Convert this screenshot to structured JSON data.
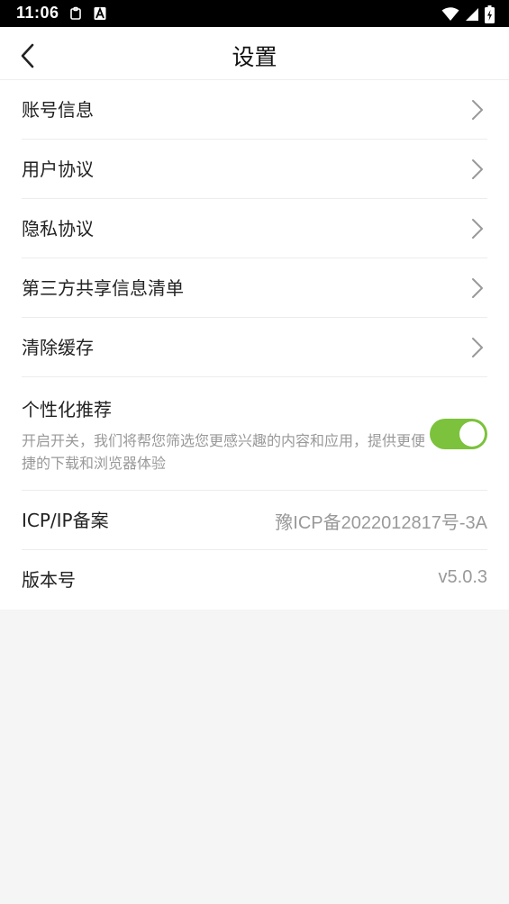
{
  "status_bar": {
    "time": "11:06",
    "icons": [
      "clipboard-icon",
      "font-a-icon",
      "wifi-icon",
      "signal-icon",
      "battery-charging-icon"
    ]
  },
  "header": {
    "title": "设置",
    "back_icon": "chevron-left-icon"
  },
  "menu": [
    {
      "label": "账号信息"
    },
    {
      "label": "用户协议"
    },
    {
      "label": "隐私协议"
    },
    {
      "label": "第三方共享信息清单"
    },
    {
      "label": "清除缓存"
    }
  ],
  "personalized": {
    "label": "个性化推荐",
    "description": "开启开关，我们将帮您筛选您更感兴趣的内容和应用，提供更便捷的下载和浏览器体验",
    "enabled": true,
    "toggle_color": "#7cc23c"
  },
  "icp": {
    "label": "ICP/IP备案",
    "value": "豫ICP备2022012817号-3A"
  },
  "version": {
    "label": "版本号",
    "value": "v5.0.3"
  }
}
